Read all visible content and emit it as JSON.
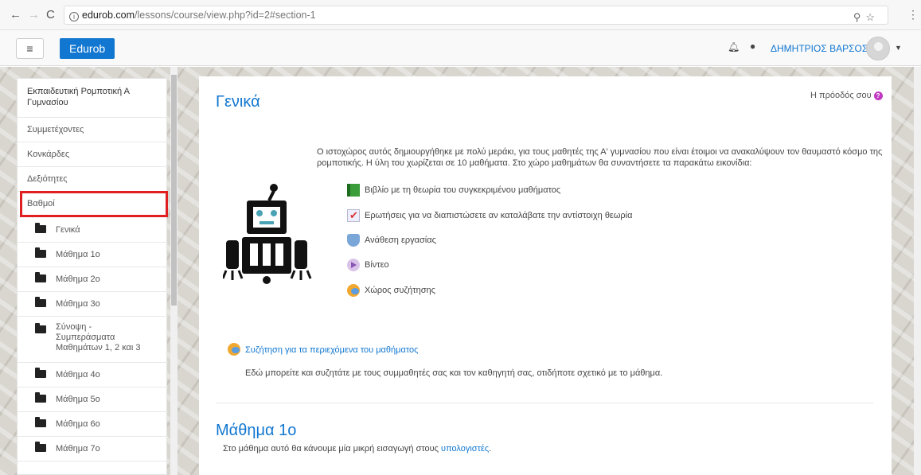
{
  "browser": {
    "url_host": "edurob.com",
    "url_path": "/lessons/course/view.php?id=2#section-1"
  },
  "navbar": {
    "brand": "Edurob",
    "user_name": "ΔΗΜΗΤΡΙΟΣ ΒΑΡΣΟΣ"
  },
  "sidebar": {
    "course_title": "Εκπαιδευτική Ρομποτική Α Γυμνασίου",
    "links": [
      "Συμμετέχοντες",
      "Κονκάρδες",
      "Δεξιότητες",
      "Βαθμοί"
    ],
    "sections": [
      "Γενικά",
      "Μάθημα 1ο",
      "Μάθημα 2ο",
      "Μάθημα 3ο",
      "Σύνοψη - Συμπεράσματα Μαθημάτων 1, 2 και 3",
      "Μάθημα 4ο",
      "Μάθημα 5ο",
      "Μάθημα 6ο",
      "Μάθημα 7ο"
    ]
  },
  "main": {
    "section_title": "Γενικά",
    "progress_label": "Η πρόοδός σου",
    "intro_text": "Ο ιστοχώρος αυτός δημιουργήθηκε με πολύ μεράκι, για τους μαθητές της Α' γυμνασίου που είναι έτοιμοι να ανακαλύψουν τον θαυμαστό κόσμο της ρομποτικής. Η ύλη του χωρίζεται σε 10 μαθήματα. Στο χώρο μαθημάτων θα συναντήσετε τα παρακάτω εικονίδια:",
    "icon_items": [
      {
        "icon": "book-icon",
        "text": "Βιβλίο με τη θεωρία του συγκεκριμένου μαθήματος"
      },
      {
        "icon": "quiz-icon",
        "text": "Ερωτήσεις για να διαπιστώσετε αν καταλάβατε την αντίστοιχη θεωρία"
      },
      {
        "icon": "assignment-icon",
        "text": "Ανάθεση εργασίας"
      },
      {
        "icon": "video-icon",
        "text": "Βίντεο"
      },
      {
        "icon": "forum-icon",
        "text": "Χώρος συζήτησης"
      }
    ],
    "forum_link": "Συζήτηση για τα περιεχόμενα του μαθήματος",
    "forum_desc": "Εδώ μπορείτε και συζητάτε με τους συμμαθητές σας και τον καθηγητή σας, οτιδήποτε σχετικό με το μάθημα.",
    "section2_title": "Μάθημα 1ο",
    "section2_desc_prefix": "Στο μάθημα αυτό θα κάνουμε μία μικρή εισαγωγή στους ",
    "section2_desc_link": "υπολογιστές",
    "section2_desc_suffix": "."
  },
  "colors": {
    "brand": "#1177d1",
    "highlight": "#e02020",
    "help": "#c039c0"
  }
}
